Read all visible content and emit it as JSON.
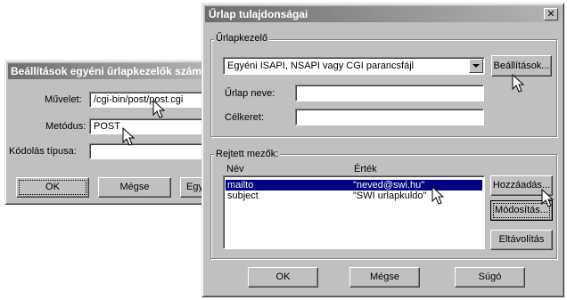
{
  "back_dialog": {
    "title": "Beállítások egyéni űrlapkezelők számá",
    "action_label": "Művelet:",
    "action_value": "/cgi-bin/post/post.cgi",
    "method_label": "Metódus:",
    "method_value": "POST",
    "encoding_label": "Kódolás típusa:",
    "encoding_value": "",
    "ok_label": "OK",
    "cancel_label": "Mégse",
    "partial_button_label": "Egy"
  },
  "front_dialog": {
    "title": "Űrlap tulajdonságai",
    "close_symbol": "✕",
    "form_handler_group_label": "Űrlapkezelő",
    "handler_dropdown_value": "Egyéni ISAPI, NSAPI vagy CGI parancsfájl",
    "settings_button_label": "Beállítások...",
    "form_name_label": "Űrlap neve:",
    "form_name_value": "",
    "target_frame_label": "Célkeret:",
    "target_frame_value": "",
    "hidden_fields_group_label": "Rejtett mezők:",
    "columns": {
      "name": "Név",
      "value": "Érték"
    },
    "hidden_fields": [
      {
        "name": "mailto",
        "value": "\"neved@swi.hu\"",
        "selected": true
      },
      {
        "name": "subject",
        "value": "\"SWI urlapkuldo\"",
        "selected": false
      }
    ],
    "add_button_label": "Hozzáadás...",
    "modify_button_label": "Módosítás...",
    "remove_button_label": "Eltávolítás",
    "ok_label": "OK",
    "cancel_label": "Mégse",
    "help_label": "Súgó"
  }
}
